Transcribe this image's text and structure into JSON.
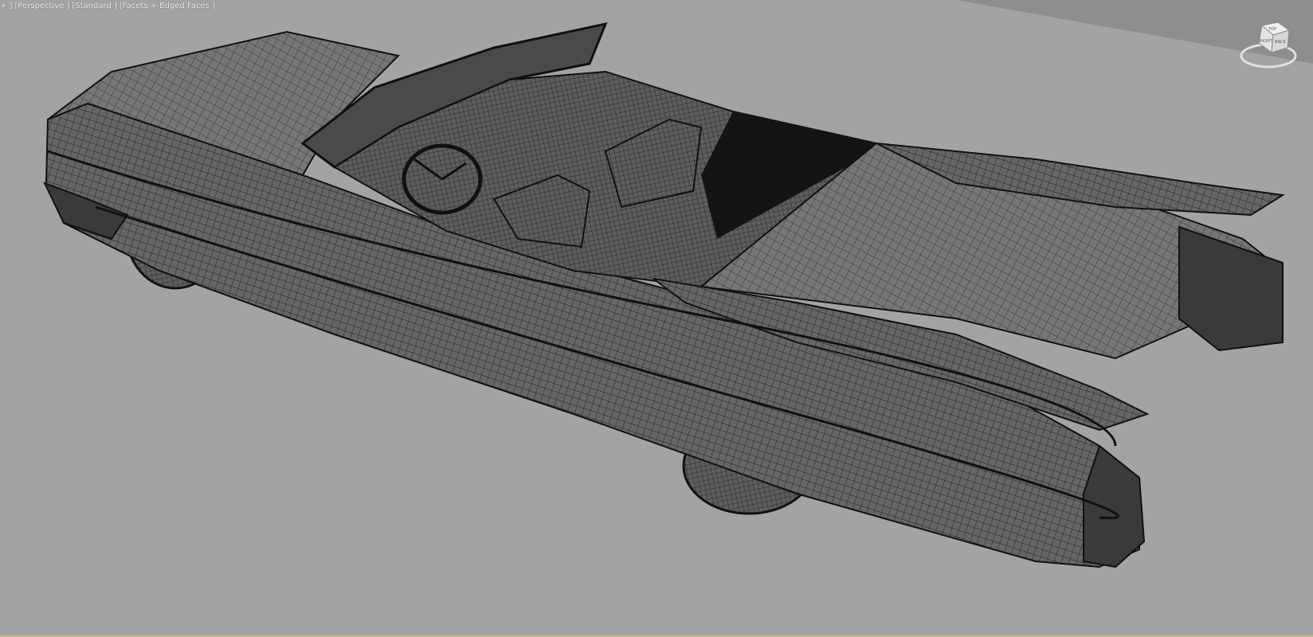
{
  "viewport": {
    "labels": {
      "menu": "+ ]",
      "view": "[Perspective ]",
      "shading_mode": "[Standard ]",
      "display_mode": "[Facets + Edged Faces ]"
    },
    "viewcube": {
      "face_top": "TOP",
      "face_right": "RIGHT",
      "face_back": "BACK",
      "icon": "viewcube-icon"
    },
    "scene": {
      "object": "car-model-wireframe",
      "ground_plane": "ground-plane"
    }
  },
  "colors": {
    "background": "#a3a3a3",
    "ground_top": "#8e8e8e",
    "mesh_fill": "#6a6a6a",
    "mesh_dark": "#2d2d2d",
    "mesh_lines": "#1a1a1a",
    "label_text": "#f2f2f2",
    "viewcube_face": "#e8e8e8"
  }
}
